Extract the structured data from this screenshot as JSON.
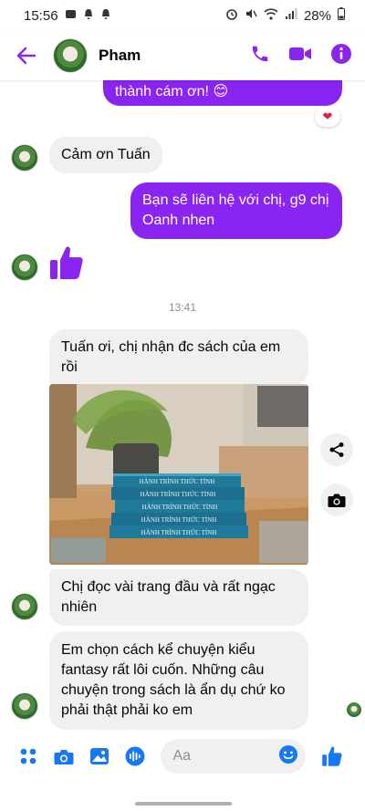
{
  "status_bar": {
    "time": "15:56",
    "battery": "28%"
  },
  "header": {
    "contact_name": "Pham"
  },
  "messages": [
    {
      "id": "m1",
      "direction": "outgoing",
      "text": "thành cám ơn! 😊",
      "reaction": "❤"
    },
    {
      "id": "m2",
      "direction": "incoming",
      "text": "Cảm ơn Tuấn"
    },
    {
      "id": "m3",
      "direction": "outgoing",
      "text": "Bạn sẽ liên hệ với chị, g9 chị Oanh nhen"
    },
    {
      "id": "m4",
      "direction": "outgoing",
      "text": "👍"
    },
    {
      "id": "m5",
      "direction": "incoming",
      "text": "Tuấn ơi, chị nhận đc sách của em rồi"
    },
    {
      "id": "m6",
      "direction": "incoming",
      "type": "photo"
    },
    {
      "id": "m7",
      "direction": "incoming",
      "text": "Chị đọc vài trang đầu và rất ngạc nhiên"
    },
    {
      "id": "m8",
      "direction": "incoming",
      "text": "Em chọn cách kể chuyện kiểu fantasy rất lôi cuốn. Những câu chuyện trong sách là ẩn dụ chứ ko phải thật phải ko em"
    }
  ],
  "timestamp": "13:41",
  "photo": {
    "book_title": "HÀNH TRÌNH THỨC TỈNH",
    "book_count": 5
  },
  "composer": {
    "placeholder": "Aa"
  },
  "colors": {
    "accent": "#8a24f0",
    "messenger_blue": "#1877f2",
    "incoming_bubble": "#f0f0f0"
  },
  "icons": [
    "back-arrow-icon",
    "phone-icon",
    "video-icon",
    "info-icon",
    "share-icon",
    "camera-icon",
    "apps-icon",
    "gallery-icon",
    "mic-icon",
    "emoji-icon",
    "like-icon"
  ]
}
